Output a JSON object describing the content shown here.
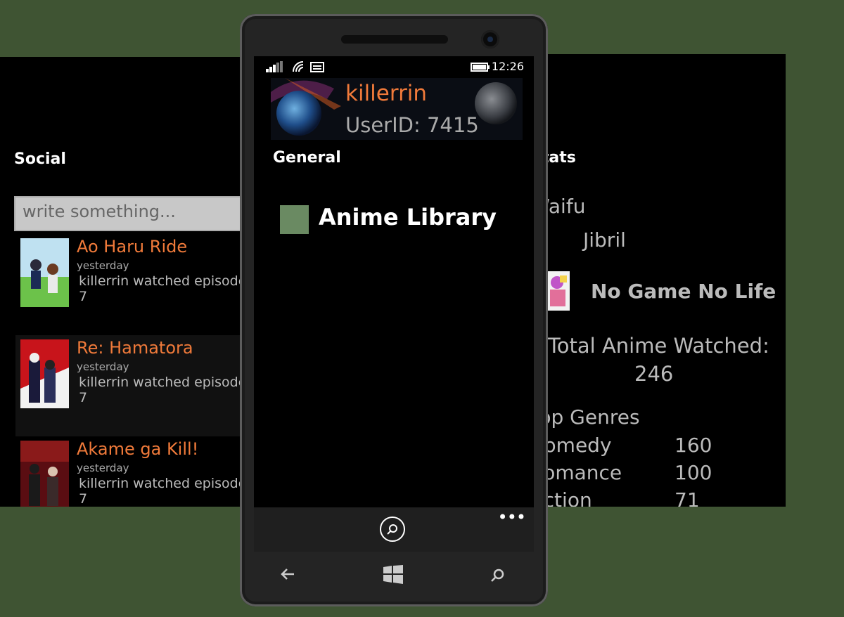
{
  "social": {
    "title": "Social",
    "search_placeholder": "write something...",
    "feed": [
      {
        "title": "Ao Haru Ride",
        "time": "yesterday",
        "line1": "killerrin watched episode",
        "line2": "7"
      },
      {
        "title": "Re: Hamatora",
        "time": "yesterday",
        "line1": "killerrin watched episode",
        "line2": "7"
      },
      {
        "title": "Akame ga Kill!",
        "time": "yesterday",
        "line1": "killerrin watched episode",
        "line2": "7"
      }
    ]
  },
  "phone": {
    "clock": "12:26",
    "profile": {
      "username": "killerrin",
      "userid": "UserID: 7415"
    },
    "section_title": "General",
    "menu_item": "Anime Library",
    "colors": {
      "accent": "#f07a3a",
      "tile": "#6a8a62"
    }
  },
  "stats": {
    "title": "Stats",
    "waifu_label": "Waifu",
    "waifu_name": "Jibril",
    "waifu_anime": "No Game No Life",
    "total_label": "Total Anime Watched:",
    "total_value": "246",
    "genres_label": "Top Genres",
    "genres": [
      {
        "name": "Comedy",
        "count": "160"
      },
      {
        "name": "Romance",
        "count": "100"
      },
      {
        "name": "Action",
        "count": "71"
      }
    ]
  }
}
